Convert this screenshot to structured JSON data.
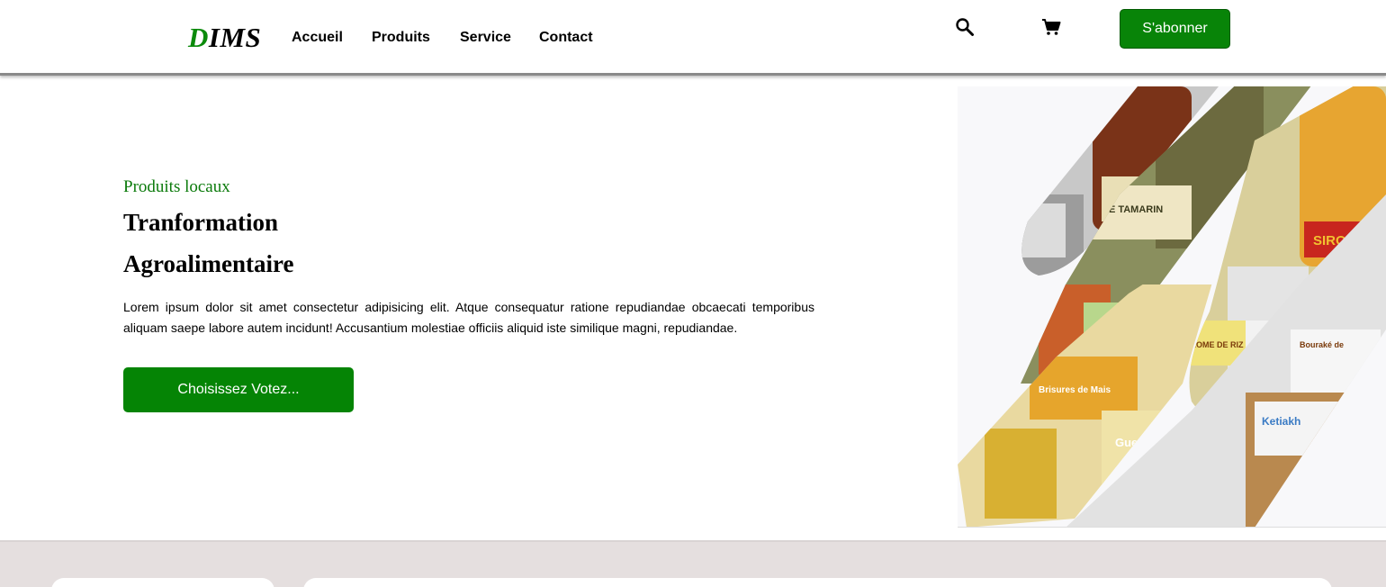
{
  "header": {
    "logo_first": "D",
    "logo_rest": "IMS",
    "nav": [
      "Accueil",
      "Produits",
      "Service",
      "Contact"
    ],
    "subscribe_label": "S'abonner",
    "icons": [
      "search-icon",
      "cart-icon"
    ]
  },
  "hero": {
    "eyebrow": "Produits locaux",
    "title_line1": "Tranformation",
    "title_line2": "Agroalimentaire",
    "description": "Lorem ipsum dolor sit amet consectetur adipisicing elit. Atque consequatur ratione repudiandae obcaecati temporibus aliquam saepe labore autem incidunt! Accusantium molestiae officiis aliquid iste similique magni, repudiandae.",
    "cta_label": "Choisissez Votez..."
  },
  "product_labels": [
    "SIROP",
    "DE TAMARIN",
    "SIROP",
    "AROME DE RIZ",
    "Brisures de Mais",
    "Guedj Beur",
    "Ketiakh",
    "Bouraké de"
  ],
  "colors": {
    "brand_green": "#088408",
    "lower_bg": "#e5dfdf"
  }
}
